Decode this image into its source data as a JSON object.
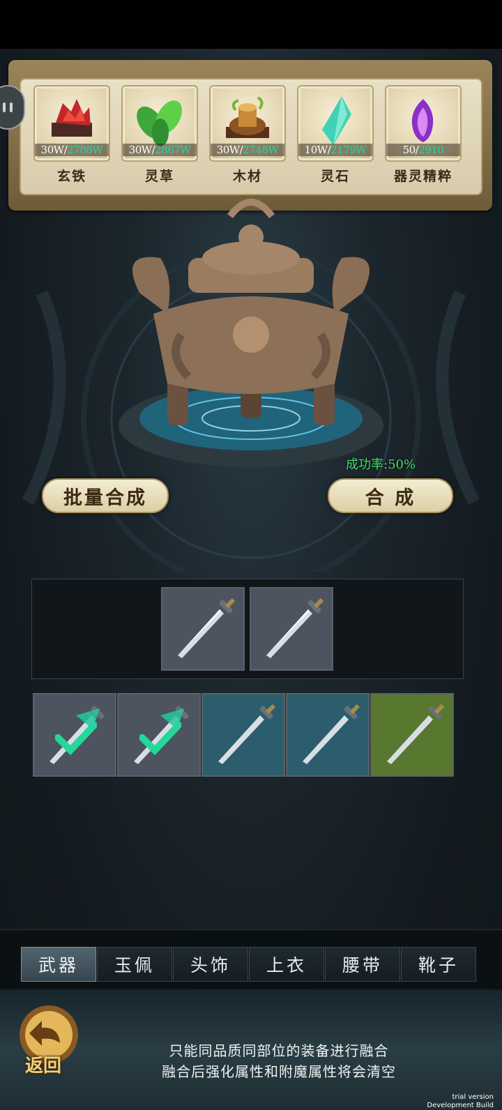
{
  "resources": [
    {
      "name": "玄铁",
      "have": "30W/",
      "need": "2788W",
      "icon": "black-iron-ore-icon"
    },
    {
      "name": "灵草",
      "have": "30W/",
      "need": "2867W",
      "icon": "spirit-herb-icon"
    },
    {
      "name": "木材",
      "have": "30W/",
      "need": "2748W",
      "icon": "wood-icon"
    },
    {
      "name": "灵石",
      "have": "10W/",
      "need": "2179W",
      "icon": "spirit-stone-icon"
    },
    {
      "name": "器灵精粹",
      "have": "50/",
      "need": "2910",
      "icon": "weapon-spirit-essence-icon"
    }
  ],
  "actions": {
    "batch": "批量合成",
    "synthesize": "合 成",
    "success_rate": "成功率:50%"
  },
  "tabs": [
    "武器",
    "玉佩",
    "头饰",
    "上衣",
    "腰带",
    "靴子"
  ],
  "active_tab": "武器",
  "footer": {
    "back": "返回",
    "hint_line1": "只能同品质同部位的装备进行融合",
    "hint_line2": "融合后强化属性和附魔属性将会清空"
  },
  "watermark": {
    "line1": "trial version",
    "line2": "Development Build"
  },
  "colors": {
    "accent_green": "#3fe06a",
    "need_count": "#2bd3a0",
    "quality_gray": "#4d5460",
    "quality_blue": "#2b5d6c",
    "quality_green": "#58782f"
  },
  "inventory": [
    {
      "item": "sword",
      "quality": "gray",
      "selected": true
    },
    {
      "item": "sword",
      "quality": "gray",
      "selected": true
    },
    {
      "item": "sword",
      "quality": "blue",
      "selected": false
    },
    {
      "item": "sword",
      "quality": "blue",
      "selected": false
    },
    {
      "item": "sword",
      "quality": "green",
      "selected": false
    }
  ]
}
